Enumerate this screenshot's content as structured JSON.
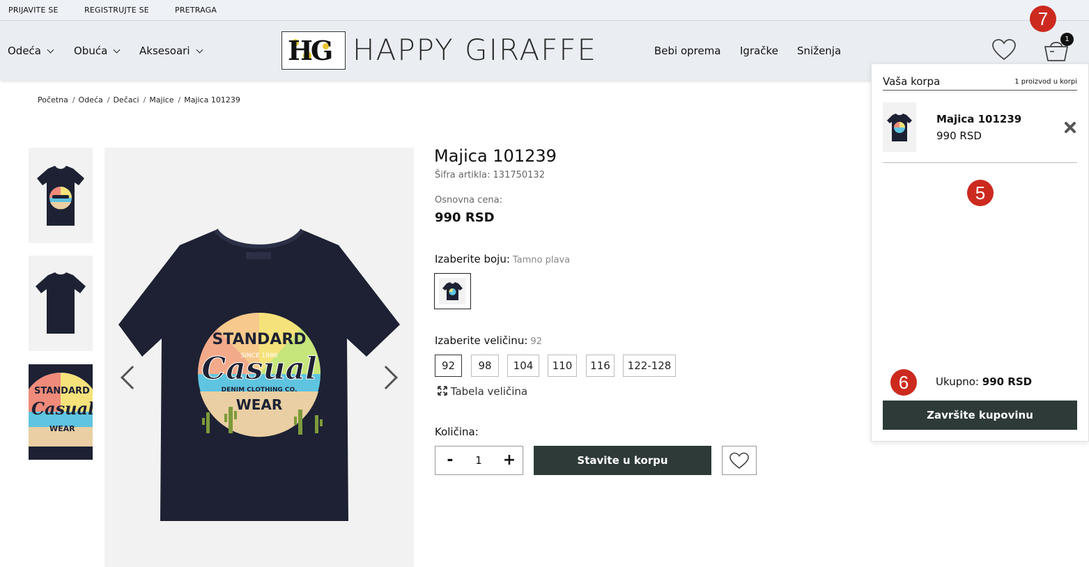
{
  "topbar": {
    "links": [
      "PRIJAVITE SE",
      "REGISTRUJTE SE",
      "PRETRAGA"
    ]
  },
  "header": {
    "nav_left": [
      "Odeća",
      "Obuća",
      "Aksesoari"
    ],
    "logo_monogram": "HG",
    "logo_text": "HAPPY GIRAFFE",
    "nav_right": [
      "Bebi oprema",
      "Igračke",
      "Sniženja"
    ],
    "cart_badge": "1",
    "icons": [
      "heart-icon",
      "basket-icon",
      "chevron-down-icon"
    ]
  },
  "breadcrumb": [
    "Početna",
    "Odeća",
    "Dečaci",
    "Majice",
    "Majica 101239"
  ],
  "product": {
    "title": "Majica 101239",
    "sku": "Šifra artikla: 131750132",
    "price_label": "Osnovna cena:",
    "price": "990 RSD",
    "color_label": "Izaberite boju:",
    "color_value": "Tamno plava",
    "size_label": "Izaberite veličinu:",
    "size_value": "92",
    "sizes": [
      "92",
      "98",
      "104",
      "110",
      "116",
      "122-128"
    ],
    "size_table": "Tabela veličina",
    "qty_label": "Količina:",
    "qty_minus": "-",
    "qty_value": "1",
    "qty_plus": "+",
    "add_to_cart": "Stavite u korpu",
    "shirt_print": {
      "top": "STANDARD",
      "since": "SINCE 1986",
      "script": "Casual",
      "brand": "DENIM CLOTHING CO.",
      "bottom": "WEAR"
    },
    "colors": {
      "shirt": "#1d2133",
      "button": "#2d3a38"
    }
  },
  "annotations": [
    "7",
    "5",
    "6"
  ],
  "cart": {
    "title": "Vaša korpa",
    "count": "1 proizvod u korpi",
    "item_name": "Majica 101239",
    "item_price": "990 RSD",
    "total_label": "Ukupno:",
    "total_value": "990 RSD",
    "checkout": "Završite kupovinu"
  }
}
